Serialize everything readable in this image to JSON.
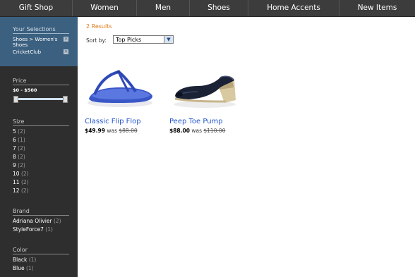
{
  "nav": [
    "Gift Shop",
    "Women",
    "Men",
    "Shoes",
    "Home Accents",
    "New Items"
  ],
  "sidebar": {
    "selections_title": "Your Selections",
    "selections": [
      {
        "label": "Shoes > Women's Shoes",
        "remove": "×"
      },
      {
        "label": "CricketClub",
        "remove": "×"
      }
    ],
    "price_title": "Price",
    "price_range": "$0 - $500",
    "price_slider": {
      "min": 0,
      "max": 500,
      "low": 0,
      "high": 500
    },
    "size_title": "Size",
    "sizes": [
      {
        "label": "5",
        "count": "(2)"
      },
      {
        "label": "6",
        "count": "(1)"
      },
      {
        "label": "7",
        "count": "(2)"
      },
      {
        "label": "8",
        "count": "(2)"
      },
      {
        "label": "9",
        "count": "(2)"
      },
      {
        "label": "10",
        "count": "(2)"
      },
      {
        "label": "11",
        "count": "(2)"
      },
      {
        "label": "12",
        "count": "(2)"
      }
    ],
    "brand_title": "Brand",
    "brands": [
      {
        "label": "Adriana Olivier",
        "count": "(2)"
      },
      {
        "label": "StyleForce7",
        "count": "(1)"
      }
    ],
    "color_title": "Color",
    "colors": [
      {
        "label": "Black",
        "count": "(1)"
      },
      {
        "label": "Blue",
        "count": "(1)"
      }
    ]
  },
  "main": {
    "results": "2 Results",
    "sort_label": "Sort by:",
    "sort_value": "Top Picks",
    "products": [
      {
        "name": "Classic Flip Flop",
        "price": "$49.99",
        "was_label": "was",
        "old_price": "$88.00"
      },
      {
        "name": "Peep Toe Pump",
        "price": "$88.00",
        "was_label": "was",
        "old_price": "$110.00"
      }
    ]
  }
}
